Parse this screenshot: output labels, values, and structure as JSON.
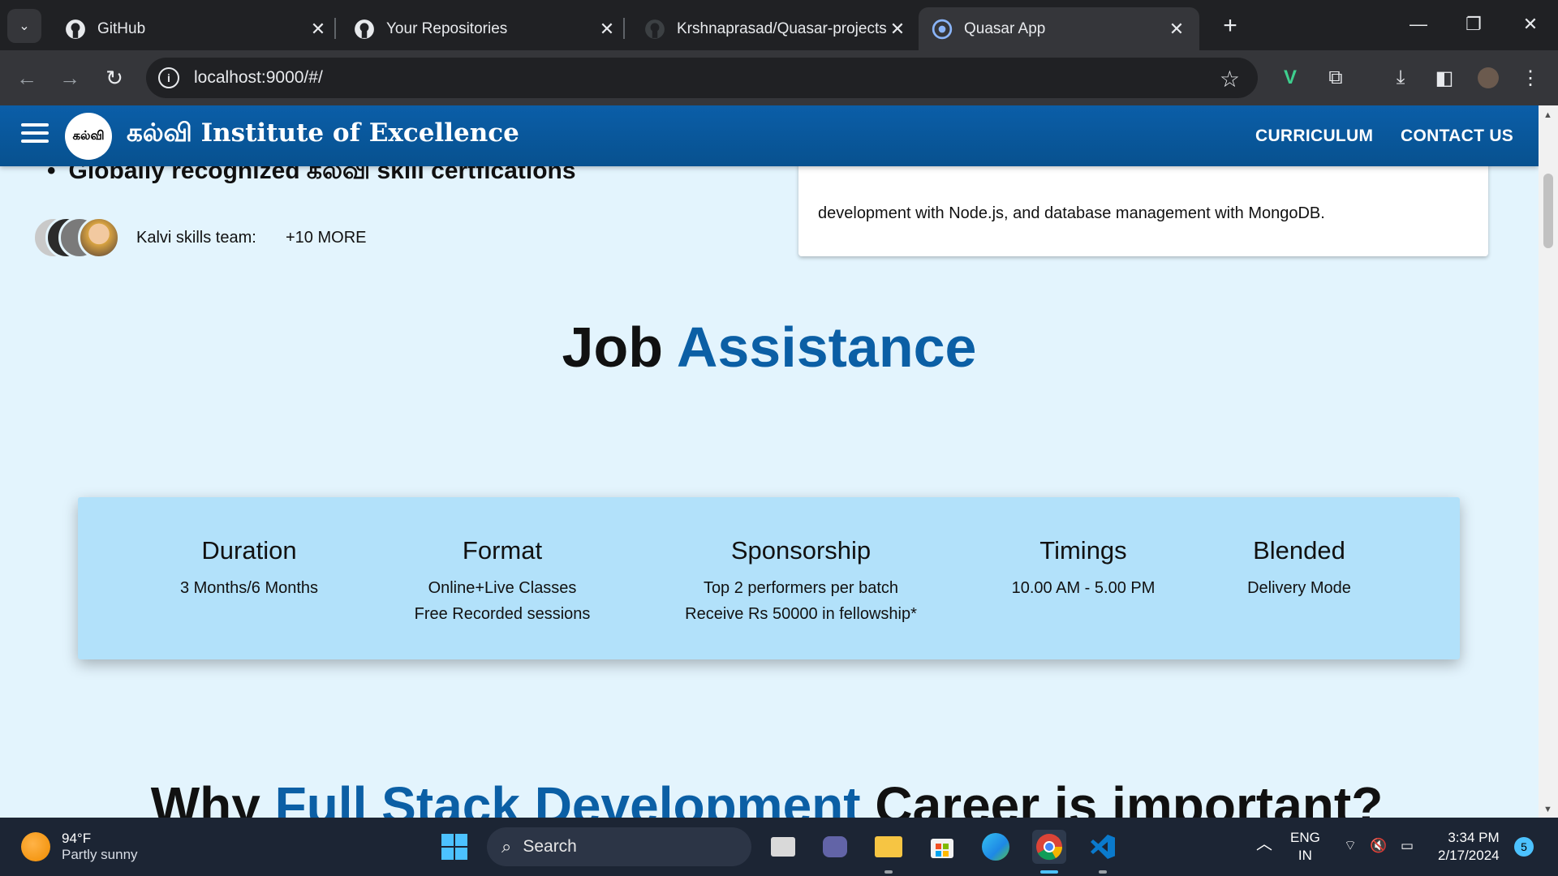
{
  "browser": {
    "tabs": [
      {
        "title": "GitHub",
        "icon": "github-icon"
      },
      {
        "title": "Your Repositories",
        "icon": "github-icon"
      },
      {
        "title": "Krshnaprasad/Quasar-projects",
        "icon": "github-icon"
      },
      {
        "title": "Quasar App",
        "icon": "quasar-icon",
        "active": true
      }
    ],
    "url": "localhost:9000/#/"
  },
  "header": {
    "logo_text": "கல்வி",
    "brand": "கல்வி Institute of Excellence",
    "nav": [
      "CURRICULUM",
      "CONTACT US"
    ]
  },
  "hero": {
    "bullet": "Globally recognized கல்வி skill certfications",
    "card_text": "development with Node.js, and database management with MongoDB.",
    "team_label": "Kalvi skills team:",
    "more_label": "+10 MORE"
  },
  "job_section": {
    "title_part1": "Job",
    "title_part2": "Assistance",
    "columns": [
      {
        "heading": "Duration",
        "lines": [
          "3 Months/6 Months"
        ]
      },
      {
        "heading": "Format",
        "lines": [
          "Online+Live Classes",
          "Free Recorded sessions"
        ]
      },
      {
        "heading": "Sponsorship",
        "lines": [
          "Top 2 performers per batch",
          "Receive Rs 50000 in fellowship*"
        ]
      },
      {
        "heading": "Timings",
        "lines": [
          "10.00 AM - 5.00 PM"
        ]
      },
      {
        "heading": "Blended",
        "lines": [
          "Delivery Mode"
        ]
      }
    ]
  },
  "why_section": {
    "part1": "Why",
    "part2": "Full Stack Development",
    "part3": "Career is important?"
  },
  "taskbar": {
    "temp": "94°F",
    "weather": "Partly sunny",
    "search": "Search",
    "lang1": "ENG",
    "lang2": "IN",
    "time": "3:34 PM",
    "date": "2/17/2024",
    "notifications": "5"
  },
  "colors": {
    "header": "#0b5ea8",
    "accent": "#0b5fa5",
    "page_bg": "#e3f4fd",
    "strip_bg": "#b2e1fa"
  }
}
